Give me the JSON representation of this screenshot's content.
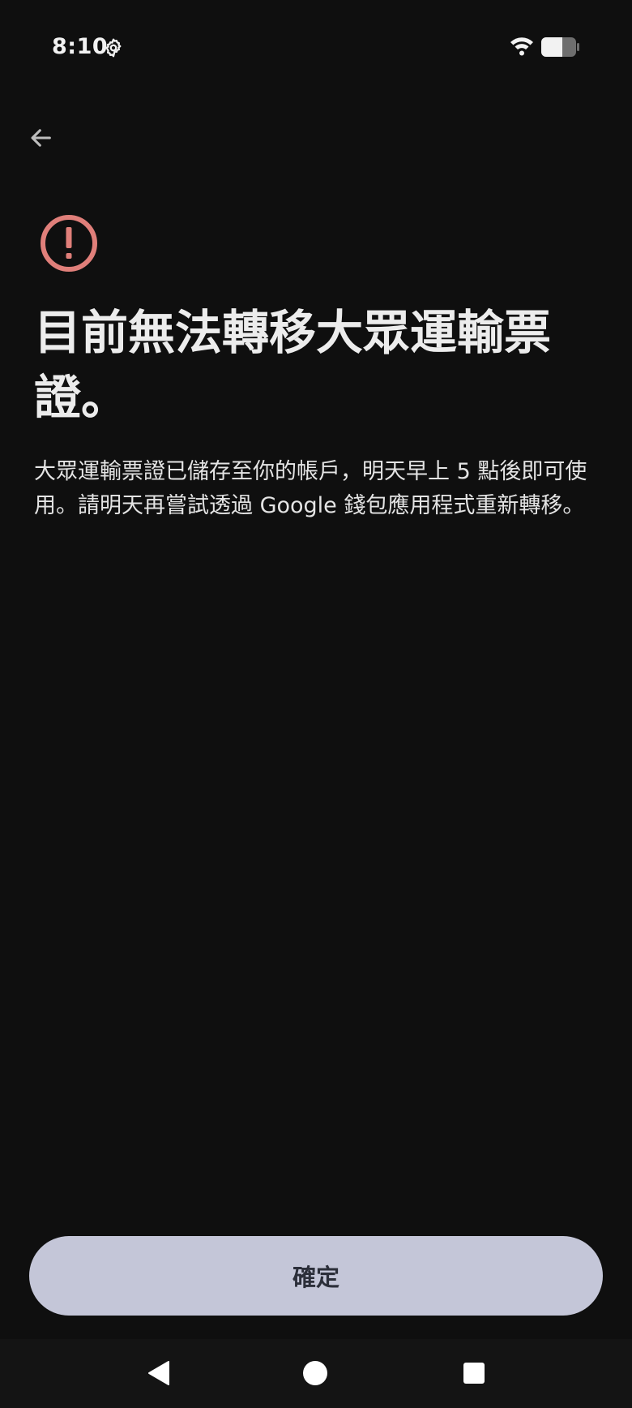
{
  "status_bar": {
    "time": "8:10",
    "settings_icon": "gear-icon",
    "wifi_icon": "wifi-icon",
    "battery_icon": "battery-icon",
    "battery_level": 0.6
  },
  "header": {
    "back_icon": "arrow-left-icon"
  },
  "content": {
    "alert_icon": "error-circle-icon",
    "alert_color": "#e07f7a",
    "title": "目前無法轉移大眾運輸票證。",
    "body": "大眾運輸票證已儲存至你的帳戶，明天早上 5 點後即可使用。請明天再嘗試透過 Google 錢包應用程式重新轉移。"
  },
  "footer": {
    "confirm_label": "確定",
    "button_color": "#c4c6d8"
  },
  "nav_bar": {
    "back_icon": "triangle-back-icon",
    "home_icon": "circle-home-icon",
    "recents_icon": "square-recents-icon"
  }
}
